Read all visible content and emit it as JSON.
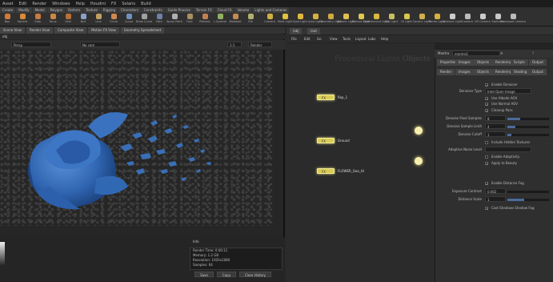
{
  "menubar": [
    "Asset",
    "Edit",
    "Render",
    "Windows",
    "Help",
    "Houdini",
    "FX",
    "Solaris",
    "Build"
  ],
  "shelf": {
    "tabs": [
      "Create",
      "Modify",
      "Model",
      "Polygon",
      "Deform",
      "Texture",
      "Rigging",
      "Characters",
      "Constraints",
      "Guide Process",
      "Terrain FX",
      "Cloud FX",
      "Volume",
      "Lights and Cameras",
      "Collisions",
      "Particles",
      "Grains",
      "Vellum",
      "Rigid Bodies"
    ],
    "left_tools": [
      {
        "label": "Box",
        "color": "#d07a3a"
      },
      {
        "label": "Sphere",
        "color": "#d98a3a"
      },
      {
        "label": "Tube",
        "color": "#c87a40"
      },
      {
        "label": "Torus",
        "color": "#cc8840"
      },
      {
        "label": "Grid",
        "color": "#b86f38"
      },
      {
        "label": "Null",
        "color": "#8aa0c8"
      },
      {
        "label": "Line",
        "color": "#c0a060"
      },
      {
        "label": "Circle",
        "color": "#d08850"
      },
      {
        "label": "Curve",
        "color": "#7090c0"
      },
      {
        "label": "Draw Curve",
        "color": "#a0a0a0"
      },
      {
        "label": "Path",
        "color": "#7080a8"
      },
      {
        "label": "Spray Paint",
        "color": "#b0b0b0"
      },
      {
        "label": "Font",
        "color": "#a89060"
      },
      {
        "label": "Platonic",
        "color": "#c08050"
      },
      {
        "label": "L-System",
        "color": "#90b060"
      },
      {
        "label": "Metaball",
        "color": "#c08a50"
      },
      {
        "label": "File",
        "color": "#b0b070"
      }
    ],
    "right_tools": [
      {
        "label": "Camera",
        "color": "#d0b040"
      },
      {
        "label": "Point Light",
        "color": "#e0c040"
      },
      {
        "label": "Spot Light",
        "color": "#e0b840"
      },
      {
        "label": "Area Light",
        "color": "#d8b040"
      },
      {
        "label": "Geometry Light",
        "color": "#d0a840"
      },
      {
        "label": "Volume Light",
        "color": "#e0c050"
      },
      {
        "label": "Distant Light",
        "color": "#e0c850"
      },
      {
        "label": "Environment Light",
        "color": "#d8b840"
      },
      {
        "label": "Sky Light",
        "color": "#c8c060"
      },
      {
        "label": "GI Light",
        "color": "#d8c850"
      },
      {
        "label": "Caustic Light",
        "color": "#d0b048"
      },
      {
        "label": "Portal Light",
        "color": "#d8b040"
      },
      {
        "label": "Ambient Light",
        "color": "#ccc"
      },
      {
        "label": "Camera",
        "color": "#bbb"
      },
      {
        "label": "VR Camera",
        "color": "#ccc"
      },
      {
        "label": "Switcher",
        "color": "#c8c8c8"
      },
      {
        "label": "Gamepad Camera",
        "color": "#bbb"
      }
    ]
  },
  "viewer": {
    "tabs": [
      "Scene View",
      "Render View",
      "Composite View",
      "Motion FX View",
      "Geometry Spreadsheet"
    ],
    "path_label": "obj",
    "view_mode": "Persp",
    "camera": "No cam",
    "fit_value": "1:1",
    "render_button": "Render"
  },
  "render_info": {
    "title": "Info",
    "lines": [
      "Render Time: 0:00:11",
      "Memory: 1.2 GB",
      "Resolution: 1920x1080",
      "Samples: 64"
    ],
    "buttons": [
      "Save",
      "Copy",
      "Clear History"
    ]
  },
  "network": {
    "path_tabs": [
      "/obj",
      "/out"
    ],
    "menu": [
      "File",
      "Edit",
      "Go",
      "View",
      "Tools",
      "Layout",
      "Labs",
      "Help"
    ],
    "watermark_1": "Procedural Lights",
    "watermark_2": "Objects",
    "nodes": [
      {
        "name": "Rop_1",
        "label": "Rop_1"
      },
      {
        "name": "Ground",
        "label": "Ground"
      },
      {
        "name": "FLOWER_Geo",
        "label": "FLOWER_Geo_Hi"
      }
    ],
    "node_icon_text": "FX"
  },
  "params": {
    "node_type": "Mantra",
    "node_name": "mantra1",
    "tabs": [
      "Properties",
      "Images",
      "Objects",
      "Rendering",
      "Scripts",
      "Output"
    ],
    "sub_tabs": [
      "Render",
      "Images",
      "Objects",
      "Rendering",
      "Shading",
      "Output"
    ],
    "rows": [
      {
        "label": "Enable Denoiser",
        "kind": "check",
        "value": "✓"
      },
      {
        "label": "Denoiser Type",
        "kind": "field",
        "value": "Intel Open Image"
      },
      {
        "label": "Use Albedo AOV",
        "kind": "check",
        "value": "✓"
      },
      {
        "label": "Use Normal AOV",
        "kind": "check",
        "value": "✓"
      },
      {
        "label": "Cleanup Pass",
        "kind": "check",
        "value": "✓"
      },
      {
        "label": "Denoise Pixel Samples",
        "kind": "slider",
        "value": "8",
        "fill": 0.3
      },
      {
        "label": "Denoise Sample Limit",
        "kind": "slider",
        "value": "4",
        "fill": 0.2
      },
      {
        "label": "Denoise Cutoff",
        "kind": "slider",
        "value": "1",
        "fill": 0.1
      },
      {
        "label": "Include Hidden Textures",
        "kind": "check",
        "value": ""
      },
      {
        "label": "Adaptive Noise Level",
        "kind": "field",
        "value": ""
      },
      {
        "label": "Enable Adaptivity",
        "kind": "check",
        "value": ""
      },
      {
        "label": "Apply to Beauty",
        "kind": "check",
        "value": "✓"
      },
      {
        "label": "Enable Distance Fog",
        "kind": "check",
        "value": "✓"
      },
      {
        "label": "Exposure Contrast",
        "kind": "slider",
        "value": "0.002",
        "fill": 0.0
      },
      {
        "label": "Distance Scale",
        "kind": "slider",
        "value": "1",
        "fill": 0.4
      },
      {
        "label": "Cast Shadows Shadow Fog",
        "kind": "check",
        "value": "✓"
      }
    ]
  },
  "colors": {
    "flower": "#3a6fb8",
    "node": "#d9cc56",
    "accent": "#4a6c9a"
  }
}
